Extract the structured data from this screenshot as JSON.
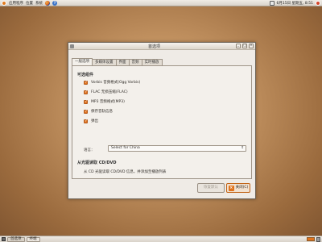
{
  "top_panel": {
    "menus": [
      "应用程序",
      "位置",
      "系统"
    ],
    "clock": "6月15日 星期五, 8:51"
  },
  "window": {
    "title": "首选项",
    "tabs": [
      "一般选项",
      "多媒体设置",
      "界面",
      "音频",
      "实时播放"
    ],
    "active_tab": 0,
    "section_title": "可选组件",
    "checkboxes": [
      {
        "label": "Vorbis 音频格式(Ogg Vorbis)",
        "checked": true
      },
      {
        "label": "FLAC 无损压缩(FLAC)",
        "checked": true
      },
      {
        "label": "MP3 音频格式(MP3)",
        "checked": true
      },
      {
        "label": "保存音轨信息",
        "checked": true
      },
      {
        "label": "弹出",
        "checked": true
      }
    ],
    "language_label": "语言：",
    "language_value": "Select for China",
    "cd_section_title": "从光驱读取 CD/DVD",
    "cd_description": "从 CD 光驱读取 CD/DVD 信息，并添加至播放列表",
    "btn_default": "恢复默认",
    "btn_close": "关闭(C)"
  },
  "bottom_panel": {
    "tasks": [
      "首选项",
      "终端"
    ]
  },
  "colors": {
    "accent": "#e0731d"
  }
}
